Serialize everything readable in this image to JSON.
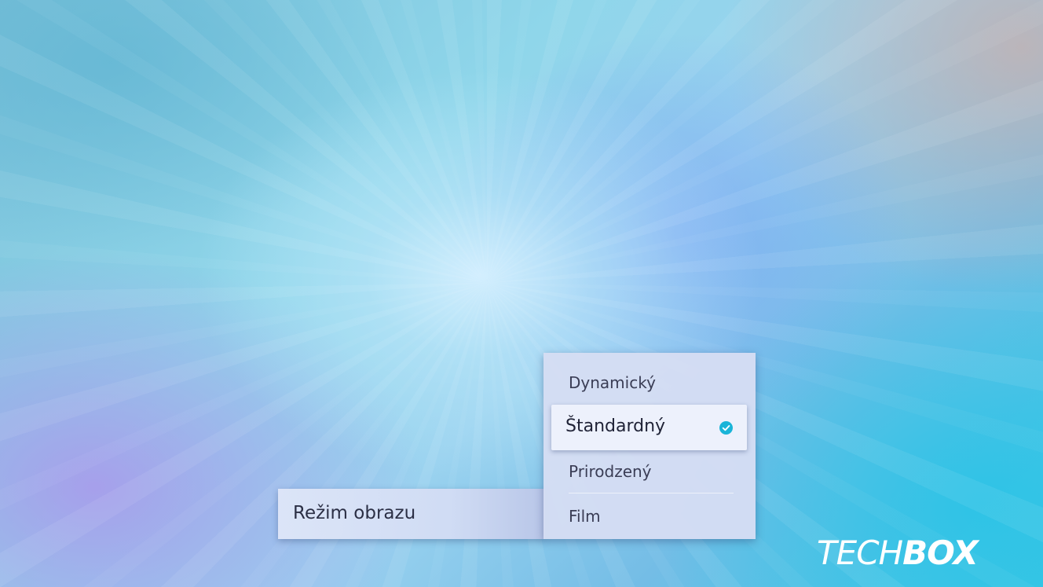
{
  "picture_mode": {
    "label": "Režim obrazu",
    "options": [
      {
        "label": "Dynamický",
        "selected": false
      },
      {
        "label": "Štandardný",
        "selected": true
      },
      {
        "label": "Prirodzený",
        "selected": false
      },
      {
        "label": "Film",
        "selected": false
      }
    ],
    "selected_value": "Štandardný"
  },
  "watermark": {
    "part1": "TECH",
    "part2": "BOX"
  },
  "colors": {
    "check_accent": "#19b4d8",
    "panel": "#d5ddf3",
    "text": "#2b2f45"
  },
  "icons": {
    "selected_check": "check-circle-icon"
  }
}
